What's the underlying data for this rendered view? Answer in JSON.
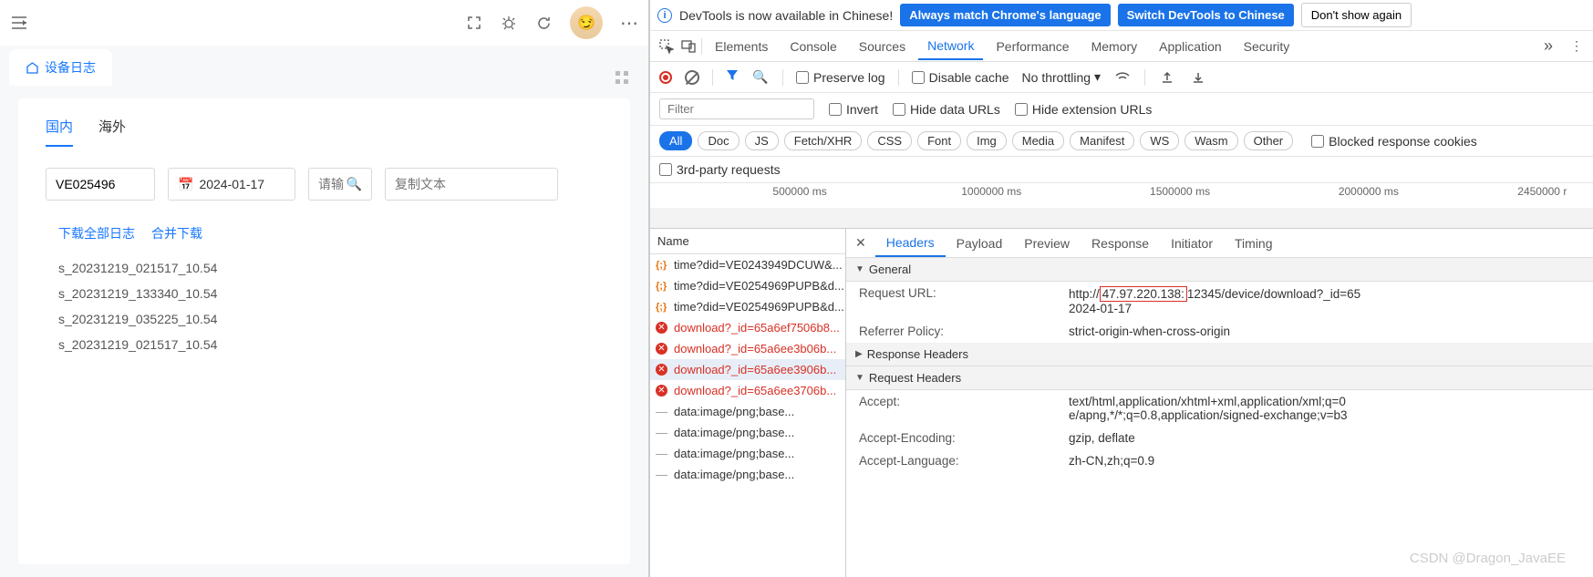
{
  "left": {
    "tab": {
      "label": "设备日志"
    },
    "innerTabs": [
      "国内",
      "海外"
    ],
    "activeInnerTab": 0,
    "deviceId": "VE025496",
    "date": "2024-01-17",
    "searchPlaceholder": "请输",
    "copyPlaceholder": "复制文本",
    "links": [
      "下载全部日志",
      "合并下载"
    ],
    "logs": [
      "s_20231219_021517_10.54",
      "s_20231219_133340_10.54",
      "s_20231219_035225_10.54",
      "s_20231219_021517_10.54"
    ]
  },
  "banner": {
    "text": "DevTools is now available in Chinese!",
    "btn1": "Always match Chrome's language",
    "btn2": "Switch DevTools to Chinese",
    "btn3": "Don't show again"
  },
  "dtTabs": [
    "Elements",
    "Console",
    "Sources",
    "Network",
    "Performance",
    "Memory",
    "Application",
    "Security"
  ],
  "dtActive": 3,
  "toolbar": {
    "preserve": "Preserve log",
    "disableCache": "Disable cache",
    "throttle": "No throttling"
  },
  "filterBar": {
    "placeholder": "Filter",
    "invert": "Invert",
    "hideData": "Hide data URLs",
    "hideExt": "Hide extension URLs"
  },
  "typePills": [
    "All",
    "Doc",
    "JS",
    "Fetch/XHR",
    "CSS",
    "Font",
    "Img",
    "Media",
    "Manifest",
    "WS",
    "Wasm",
    "Other"
  ],
  "typeActive": 0,
  "blockedCookies": "Blocked response cookies",
  "thirdParty": "3rd-party requests",
  "timeline": [
    "500000 ms",
    "1000000 ms",
    "1500000 ms",
    "2000000 ms",
    "2450000 r"
  ],
  "reqHeader": "Name",
  "requests": [
    {
      "icon": "json",
      "name": "time?did=VE0243949DCUW&...",
      "err": false,
      "ok": true
    },
    {
      "icon": "json",
      "name": "time?did=VE0254969PUPB&d...",
      "err": false,
      "ok": true
    },
    {
      "icon": "json",
      "name": "time?did=VE0254969PUPB&d...",
      "err": false,
      "ok": true
    },
    {
      "icon": "err",
      "name": "download?_id=65a6ef7506b8...",
      "err": true
    },
    {
      "icon": "err",
      "name": "download?_id=65a6ee3b06b...",
      "err": true
    },
    {
      "icon": "err",
      "name": "download?_id=65a6ee3906b...",
      "err": true,
      "sel": true
    },
    {
      "icon": "err",
      "name": "download?_id=65a6ee3706b...",
      "err": true
    },
    {
      "icon": "dash",
      "name": "data:image/png;base...",
      "ok": true
    },
    {
      "icon": "dash",
      "name": "data:image/png;base...",
      "ok": true
    },
    {
      "icon": "dash",
      "name": "data:image/png;base...",
      "ok": true
    },
    {
      "icon": "dash",
      "name": "data:image/png;base...",
      "ok": true
    }
  ],
  "detailTabs": [
    "Headers",
    "Payload",
    "Preview",
    "Response",
    "Initiator",
    "Timing"
  ],
  "detailActive": 0,
  "sections": {
    "general": "General",
    "respH": "Response Headers",
    "reqH": "Request Headers"
  },
  "general": {
    "reqUrlK": "Request URL:",
    "reqUrlPrefix": "http://",
    "reqUrlBox": "47.97.220.138:",
    "reqUrlSuffix": "12345/device/download?_id=65",
    "reqUrlLine2": "2024-01-17",
    "refPolK": "Referrer Policy:",
    "refPolV": "strict-origin-when-cross-origin"
  },
  "reqHeaders": {
    "acceptK": "Accept:",
    "acceptV1": "text/html,application/xhtml+xml,application/xml;q=0",
    "acceptV2": "e/apng,*/*;q=0.8,application/signed-exchange;v=b3",
    "encK": "Accept-Encoding:",
    "encV": "gzip, deflate",
    "langK": "Accept-Language:",
    "langV": "zh-CN,zh;q=0.9"
  },
  "watermark": "CSDN @Dragon_JavaEE"
}
